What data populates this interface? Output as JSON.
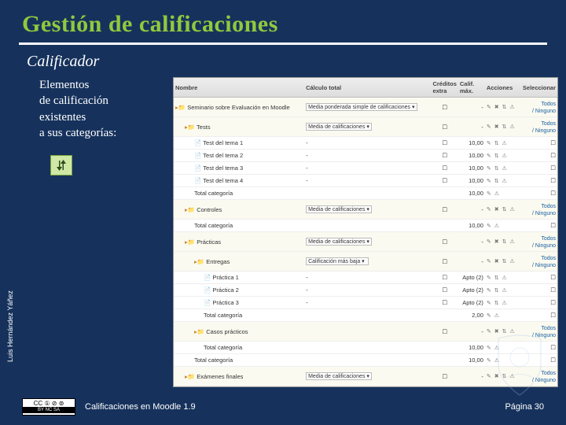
{
  "title": "Gestión de calificaciones",
  "subtitle": "Calificador",
  "body": {
    "line1": "Elementos",
    "line2": "de calificación",
    "line3": "existentes",
    "line4": "a sus categorías:"
  },
  "icon_name": "move-icon",
  "screenshot": {
    "headers": [
      "Nombre",
      "Cálculo total",
      "Créditos extra",
      "Calif. máx.",
      "Acciones",
      "Seleccionar"
    ],
    "toggle_all": "Todos\n/ Ninguno",
    "rows": [
      {
        "type": "cat",
        "indent": 0,
        "icon": "fold",
        "name": "Seminario sobre Evaluación en Moodle",
        "calc": "Media ponderada simple de calificaciones",
        "val": "-",
        "acts": "✎ ✖ ⇅ ⚠",
        "toggle": true
      },
      {
        "type": "cat",
        "indent": 1,
        "icon": "fold",
        "name": "Tests",
        "calc": "Media de calificaciones",
        "val": "-",
        "acts": "✎ ✖ ⇅ ⚠",
        "toggle": true
      },
      {
        "type": "item",
        "indent": 2,
        "icon": "doc",
        "name": "Test del tema 1",
        "calc": "-",
        "val": "10,00",
        "acts": "✎ ⇅ ⚠",
        "toggle": false
      },
      {
        "type": "item",
        "indent": 2,
        "icon": "doc",
        "name": "Test del tema 2",
        "calc": "-",
        "val": "10,00",
        "acts": "✎ ⇅ ⚠",
        "toggle": false
      },
      {
        "type": "item",
        "indent": 2,
        "icon": "doc",
        "name": "Test del tema 3",
        "calc": "-",
        "val": "10,00",
        "acts": "✎ ⇅ ⚠",
        "toggle": false
      },
      {
        "type": "item",
        "indent": 2,
        "icon": "doc",
        "name": "Test del tema 4",
        "calc": "-",
        "val": "10,00",
        "acts": "✎ ⇅ ⚠",
        "toggle": false
      },
      {
        "type": "sum",
        "indent": 2,
        "icon": "",
        "name": "Total categoría",
        "calc": "",
        "val": "10,00",
        "acts": "✎ ⚠",
        "toggle": false
      },
      {
        "type": "cat",
        "indent": 1,
        "icon": "fold",
        "name": "Controles",
        "calc": "Media de calificaciones",
        "val": "-",
        "acts": "✎ ✖ ⇅ ⚠",
        "toggle": true
      },
      {
        "type": "sum",
        "indent": 2,
        "icon": "",
        "name": "Total categoría",
        "calc": "",
        "val": "10,00",
        "acts": "✎ ⚠",
        "toggle": false
      },
      {
        "type": "cat",
        "indent": 1,
        "icon": "fold",
        "name": "Prácticas",
        "calc": "Media de calificaciones",
        "val": "-",
        "acts": "✎ ✖ ⇅ ⚠",
        "toggle": true
      },
      {
        "type": "cat",
        "indent": 2,
        "icon": "fold",
        "name": "Entregas",
        "calc": "Calificación más baja",
        "val": "-",
        "acts": "✎ ✖ ⇅ ⚠",
        "toggle": true
      },
      {
        "type": "item",
        "indent": 3,
        "icon": "doc",
        "name": "Práctica 1",
        "calc": "-",
        "val": "Apto (2)",
        "acts": "✎ ⇅ ⚠",
        "toggle": false
      },
      {
        "type": "item",
        "indent": 3,
        "icon": "doc",
        "name": "Práctica 2",
        "calc": "-",
        "val": "Apto (2)",
        "acts": "✎ ⇅ ⚠",
        "toggle": false
      },
      {
        "type": "item",
        "indent": 3,
        "icon": "doc",
        "name": "Práctica 3",
        "calc": "-",
        "val": "Apto (2)",
        "acts": "✎ ⇅ ⚠",
        "toggle": false
      },
      {
        "type": "sum",
        "indent": 3,
        "icon": "",
        "name": "Total categoría",
        "calc": "",
        "val": "2,00",
        "acts": "✎ ⚠",
        "toggle": false
      },
      {
        "type": "cat",
        "indent": 2,
        "icon": "fold",
        "name": "Casos prácticos",
        "calc": "",
        "val": "-",
        "acts": "✎ ✖ ⇅ ⚠",
        "toggle": true
      },
      {
        "type": "sum",
        "indent": 3,
        "icon": "",
        "name": "Total categoría",
        "calc": "",
        "val": "10,00",
        "acts": "✎ ⚠",
        "toggle": false
      },
      {
        "type": "sum",
        "indent": 2,
        "icon": "",
        "name": "Total categoría",
        "calc": "",
        "val": "10,00",
        "acts": "✎ ⚠",
        "toggle": false
      },
      {
        "type": "cat",
        "indent": 1,
        "icon": "fold",
        "name": "Exámenes finales",
        "calc": "Media de calificaciones",
        "val": "-",
        "acts": "✎ ✖ ⇅ ⚠",
        "toggle": true
      }
    ]
  },
  "author": "Luis Hernández Yáñez",
  "footer": {
    "course": "Calificaciones en Moodle 1.9",
    "page": "Página 30"
  },
  "cc": {
    "top": "CC ① ⊘ ⊚",
    "bottom": "BY  NC  SA"
  }
}
